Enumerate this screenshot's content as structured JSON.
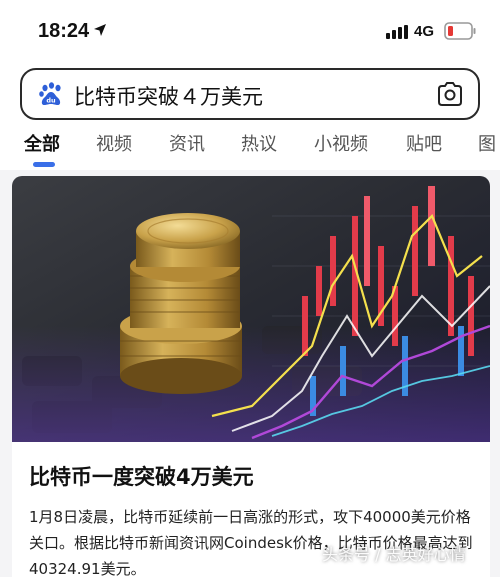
{
  "status": {
    "time": "18:24",
    "network": "4G"
  },
  "search": {
    "query": "比特币突破４万美元"
  },
  "tabs": [
    {
      "label": "全部"
    },
    {
      "label": "视频"
    },
    {
      "label": "资讯"
    },
    {
      "label": "热议"
    },
    {
      "label": "小视频"
    },
    {
      "label": "贴吧"
    },
    {
      "label": "图"
    }
  ],
  "article": {
    "title": "比特币一度突破4万美元",
    "body": "1月8日凌晨，比特币延续前一日高涨的形式，攻下40000美元价格关口。根据比特币新闻资讯网Coindesk价格，比特币价格最高达到40324.91美元。"
  },
  "watermark": {
    "text": "头条号 / 志英好心情"
  },
  "colors": {
    "accent": "#3a6fe8",
    "baidu_blue": "#2e5fd8",
    "battery_red": "#e53935"
  }
}
